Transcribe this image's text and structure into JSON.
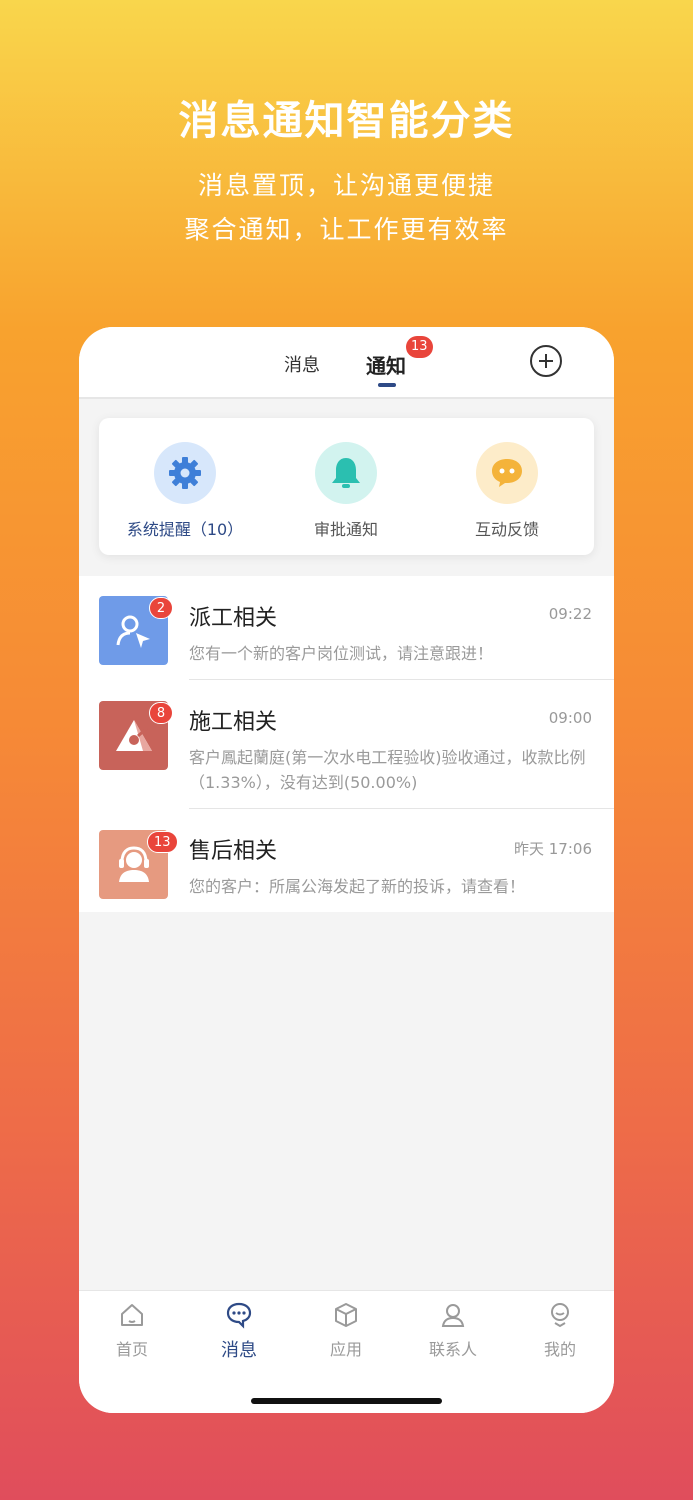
{
  "hero": {
    "title": "消息通知智能分类",
    "subtitle1": "消息置顶，让沟通更便捷",
    "subtitle2": "聚合通知，让工作更有效率"
  },
  "topbar": {
    "tabs": [
      {
        "label": "消息"
      },
      {
        "label": "通知",
        "badge": "13",
        "active": true
      }
    ],
    "add_icon": "plus-circle-icon"
  },
  "categories": [
    {
      "label": "系统提醒（10）",
      "icon": "gear-icon",
      "color": "#3e7fd8"
    },
    {
      "label": "审批通知",
      "icon": "bell-icon",
      "color": "#2bbfb0"
    },
    {
      "label": "互动反馈",
      "icon": "chat-bubble-icon",
      "color": "#f4b33a"
    }
  ],
  "notifications": [
    {
      "title": "派工相关",
      "time": "09:22",
      "badge": "2",
      "desc": "您有一个新的客户岗位测试，请注意跟进！",
      "icon": "dispatch-user-icon",
      "color": "#6f9be8"
    },
    {
      "title": "施工相关",
      "time": "09:00",
      "badge": "8",
      "desc": "客户鳳起蘭庭(第一次水电工程验收)验收通过，收款比例（1.33%），没有达到(50.00%)",
      "icon": "construction-icon",
      "color": "#c8635a"
    },
    {
      "title": "售后相关",
      "time": "昨天 17:06",
      "badge": "13",
      "desc": "您的客户：所属公海发起了新的投诉，请查看！",
      "icon": "headset-icon",
      "color": "#e69a80"
    }
  ],
  "tabbar": {
    "items": [
      {
        "label": "首页",
        "icon": "home-icon"
      },
      {
        "label": "消息",
        "icon": "message-icon",
        "active": true
      },
      {
        "label": "应用",
        "icon": "cube-icon"
      },
      {
        "label": "联系人",
        "icon": "contact-icon"
      },
      {
        "label": "我的",
        "icon": "profile-icon"
      }
    ]
  },
  "colors": {
    "accent": "#2e4a86",
    "badge": "#e9453b"
  }
}
